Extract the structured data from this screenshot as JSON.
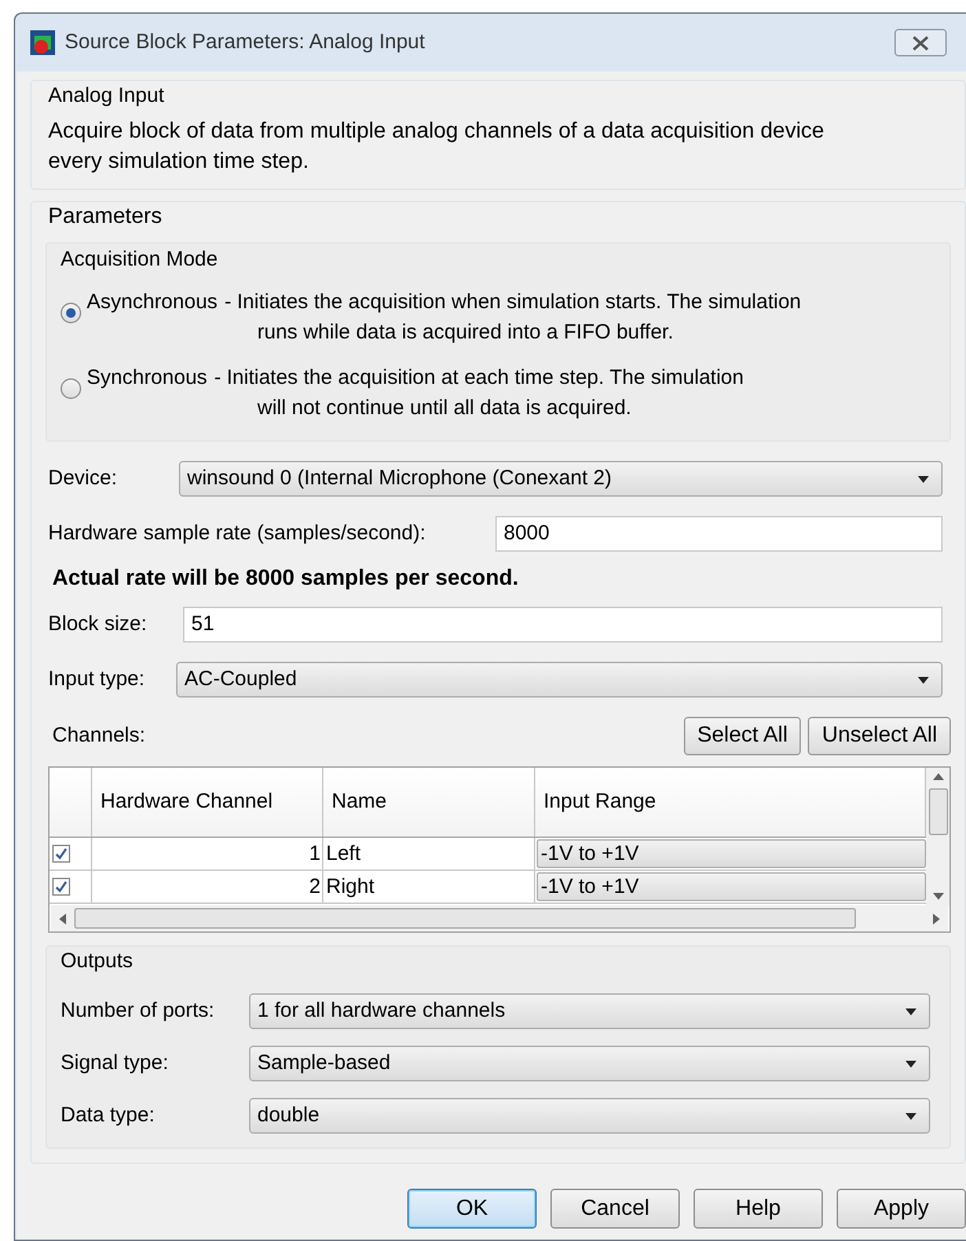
{
  "window": {
    "title": "Source Block Parameters: Analog Input"
  },
  "description": {
    "title": "Analog Input",
    "text": "Acquire block of data from multiple analog channels of a data acquisition device every simulation time step."
  },
  "parameters": {
    "title": "Parameters",
    "acquisition_mode": {
      "title": "Acquisition Mode",
      "options": [
        {
          "label": "Asynchronous",
          "lines": [
            "- Initiates the acquisition when simulation starts. The simulation",
            "runs while data is acquired into a FIFO buffer."
          ],
          "selected": true
        },
        {
          "label": "Synchronous",
          "lines": [
            "- Initiates the acquisition at each time step. The simulation",
            "will not continue until all data is acquired."
          ],
          "selected": false
        }
      ]
    },
    "device": {
      "label": "Device:",
      "value": "winsound 0 (Internal Microphone (Conexant 2)"
    },
    "sample_rate": {
      "label": "Hardware sample rate (samples/second):",
      "value": "8000"
    },
    "rate_note": "Actual rate will be 8000 samples per second.",
    "block_size": {
      "label": "Block size:",
      "value": "51"
    },
    "input_type": {
      "label": "Input type:",
      "value": "AC-Coupled"
    },
    "channels": {
      "label": "Channels:",
      "buttons": [
        "Select All",
        "Unselect All"
      ],
      "columns": [
        "Hardware Channel",
        "Name",
        "Input Range"
      ],
      "rows": [
        {
          "checked": true,
          "hardware_channel": "1",
          "name": "Left",
          "input_range": "-1V to +1V"
        },
        {
          "checked": true,
          "hardware_channel": "2",
          "name": "Right",
          "input_range": "-1V to +1V"
        }
      ]
    },
    "outputs": {
      "title": "Outputs",
      "fields": [
        {
          "label": "Number of ports:",
          "value": "1 for all hardware channels"
        },
        {
          "label": "Signal type:",
          "value": "Sample-based"
        },
        {
          "label": "Data type:",
          "value": "double"
        }
      ]
    }
  },
  "buttons": [
    {
      "label": "OK",
      "default": true
    },
    {
      "label": "Cancel",
      "default": false
    },
    {
      "label": "Help",
      "default": false
    },
    {
      "label": "Apply",
      "default": false
    }
  ]
}
